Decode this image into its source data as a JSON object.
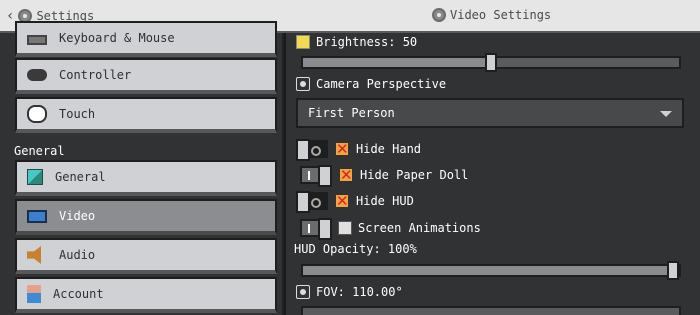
{
  "header": {
    "back_label": "Settings",
    "title": "Video Settings"
  },
  "sidebar": {
    "items_top": [
      {
        "label": "Keyboard & Mouse",
        "icon": "keyboard-icon"
      },
      {
        "label": "Controller",
        "icon": "controller-icon"
      },
      {
        "label": "Touch",
        "icon": "touch-icon"
      }
    ],
    "section_label": "General",
    "items_general": [
      {
        "label": "General",
        "icon": "cube-icon"
      },
      {
        "label": "Video",
        "icon": "monitor-icon",
        "active": true
      },
      {
        "label": "Audio",
        "icon": "speaker-icon"
      },
      {
        "label": "Account",
        "icon": "account-icon"
      }
    ]
  },
  "settings": {
    "brightness_label": "Brightness: 50",
    "brightness_value": 50,
    "camera_label": "Camera Perspective",
    "camera_value": "First Person",
    "hide_hand_label": "Hide Hand",
    "hide_hand_on": false,
    "hide_paper_doll_label": "Hide Paper Doll",
    "hide_paper_doll_on": true,
    "hide_hud_label": "Hide HUD",
    "hide_hud_on": false,
    "screen_animations_label": "Screen Animations",
    "screen_animations_on": true,
    "hud_opacity_label": "HUD Opacity: 100%",
    "hud_opacity_value": 100,
    "fov_label": "FOV: 110.00°"
  },
  "colors": {
    "panel_bg": "#313233",
    "button_bg": "#d0d1d4",
    "active_button_bg": "#8c8d90",
    "topbar_bg": "#e6e6e6"
  }
}
